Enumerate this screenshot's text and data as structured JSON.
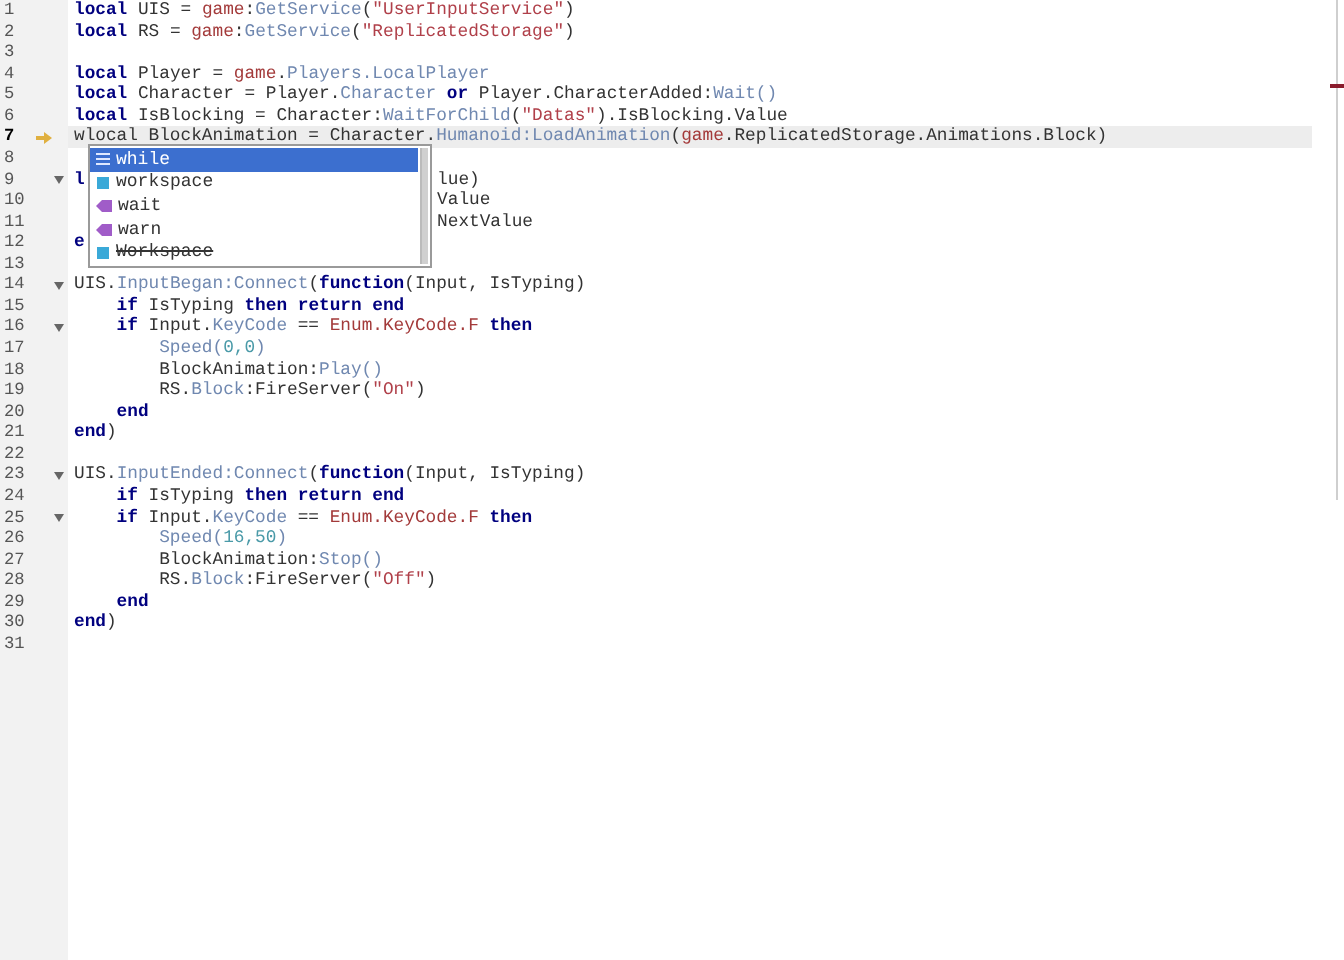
{
  "editor": {
    "lines": [
      {
        "number": "1",
        "fold": false,
        "current": false,
        "tokens": [
          {
            "kind": "keyword",
            "text": "local "
          },
          {
            "kind": "text",
            "text": "UIS = "
          },
          {
            "kind": "global",
            "text": "game"
          },
          {
            "kind": "text",
            "text": ":"
          },
          {
            "kind": "member",
            "text": "GetService"
          },
          {
            "kind": "text",
            "text": "("
          },
          {
            "kind": "string",
            "text": "\"UserInputService\""
          },
          {
            "kind": "text",
            "text": ")"
          }
        ]
      },
      {
        "number": "2",
        "fold": false,
        "current": false,
        "tokens": [
          {
            "kind": "keyword",
            "text": "local "
          },
          {
            "kind": "text",
            "text": "RS = "
          },
          {
            "kind": "global",
            "text": "game"
          },
          {
            "kind": "text",
            "text": ":"
          },
          {
            "kind": "member",
            "text": "GetService"
          },
          {
            "kind": "text",
            "text": "("
          },
          {
            "kind": "string",
            "text": "\"ReplicatedStorage\""
          },
          {
            "kind": "text",
            "text": ")"
          }
        ]
      },
      {
        "number": "3",
        "fold": false,
        "current": false
      },
      {
        "number": "4",
        "fold": false,
        "current": false,
        "tokens": [
          {
            "kind": "keyword",
            "text": "local "
          },
          {
            "kind": "text",
            "text": "Player = "
          },
          {
            "kind": "global",
            "text": "game"
          },
          {
            "kind": "text",
            "text": "."
          },
          {
            "kind": "member",
            "text": "Players.LocalPlayer"
          }
        ]
      },
      {
        "number": "5",
        "fold": false,
        "current": false,
        "tokens": [
          {
            "kind": "keyword",
            "text": "local "
          },
          {
            "kind": "text",
            "text": "Character = Player."
          },
          {
            "kind": "member",
            "text": "Character"
          },
          {
            "kind": "keyword",
            "text": " or"
          },
          {
            "kind": "text",
            "text": " Player.CharacterAdded:"
          },
          {
            "kind": "member",
            "text": "Wait()"
          }
        ]
      },
      {
        "number": "6",
        "fold": false,
        "current": false,
        "tokens": [
          {
            "kind": "keyword",
            "text": "local "
          },
          {
            "kind": "text",
            "text": "IsBlocking = Character:"
          },
          {
            "kind": "member",
            "text": "WaitForChild"
          },
          {
            "kind": "text",
            "text": "("
          },
          {
            "kind": "string",
            "text": "\"Datas\""
          },
          {
            "kind": "text",
            "text": ").IsBlocking.Value"
          }
        ]
      },
      {
        "number": "7",
        "fold": false,
        "current": true,
        "tokens": [
          {
            "kind": "text",
            "text": "wlocal BlockAnimation = Character."
          },
          {
            "kind": "member",
            "text": "Humanoid:LoadAnimation"
          },
          {
            "kind": "text",
            "text": "("
          },
          {
            "kind": "global",
            "text": "game"
          },
          {
            "kind": "text",
            "text": ".ReplicatedStorage.Animations.Block)"
          }
        ]
      },
      {
        "number": "8",
        "fold": false,
        "current": false
      },
      {
        "number": "9",
        "fold": true,
        "current": false,
        "tokens": [
          {
            "kind": "keyword",
            "text": "l"
          }
        ],
        "tail": [
          {
            "kind": "text",
            "text": "lue)"
          }
        ]
      },
      {
        "number": "10",
        "fold": false,
        "current": false,
        "tail": [
          {
            "kind": "text",
            "text": "Value"
          }
        ]
      },
      {
        "number": "11",
        "fold": false,
        "current": false,
        "tail": [
          {
            "kind": "text",
            "text": "NextValue"
          }
        ]
      },
      {
        "number": "12",
        "fold": false,
        "current": false,
        "tokens": [
          {
            "kind": "keyword",
            "text": "e"
          }
        ]
      },
      {
        "number": "13",
        "fold": false,
        "current": false
      },
      {
        "number": "14",
        "fold": true,
        "current": false,
        "tokens": [
          {
            "kind": "text",
            "text": "UIS."
          },
          {
            "kind": "member",
            "text": "InputBegan:Connect"
          },
          {
            "kind": "text",
            "text": "("
          },
          {
            "kind": "keyword",
            "text": "function"
          },
          {
            "kind": "text",
            "text": "(Input, IsTyping)"
          }
        ]
      },
      {
        "number": "15",
        "fold": false,
        "current": false,
        "tokens": [
          {
            "kind": "keyword",
            "text": "    if"
          },
          {
            "kind": "text",
            "text": " IsTyping "
          },
          {
            "kind": "keyword",
            "text": "then return end"
          }
        ]
      },
      {
        "number": "16",
        "fold": true,
        "current": false,
        "tokens": [
          {
            "kind": "keyword",
            "text": "    if"
          },
          {
            "kind": "text",
            "text": " Input."
          },
          {
            "kind": "member",
            "text": "KeyCode"
          },
          {
            "kind": "text",
            "text": " == "
          },
          {
            "kind": "global",
            "text": "Enum.KeyCode.F"
          },
          {
            "kind": "keyword",
            "text": " then"
          }
        ]
      },
      {
        "number": "17",
        "fold": false,
        "current": false,
        "tokens": [
          {
            "kind": "member",
            "text": "        Speed("
          },
          {
            "kind": "number",
            "text": "0,0"
          },
          {
            "kind": "member",
            "text": ")"
          }
        ]
      },
      {
        "number": "18",
        "fold": false,
        "current": false,
        "tokens": [
          {
            "kind": "text",
            "text": "        BlockAnimation:"
          },
          {
            "kind": "member",
            "text": "Play()"
          }
        ]
      },
      {
        "number": "19",
        "fold": false,
        "current": false,
        "tokens": [
          {
            "kind": "text",
            "text": "        RS."
          },
          {
            "kind": "member",
            "text": "Block"
          },
          {
            "kind": "text",
            "text": ":FireServer("
          },
          {
            "kind": "string",
            "text": "\"On\""
          },
          {
            "kind": "text",
            "text": ")"
          }
        ]
      },
      {
        "number": "20",
        "fold": false,
        "current": false,
        "tokens": [
          {
            "kind": "keyword",
            "text": "    end"
          }
        ]
      },
      {
        "number": "21",
        "fold": false,
        "current": false,
        "tokens": [
          {
            "kind": "keyword",
            "text": "end"
          },
          {
            "kind": "text",
            "text": ")"
          }
        ]
      },
      {
        "number": "22",
        "fold": false,
        "current": false
      },
      {
        "number": "23",
        "fold": true,
        "current": false,
        "tokens": [
          {
            "kind": "text",
            "text": "UIS."
          },
          {
            "kind": "member",
            "text": "InputEnded:Connect"
          },
          {
            "kind": "text",
            "text": "("
          },
          {
            "kind": "keyword",
            "text": "function"
          },
          {
            "kind": "text",
            "text": "(Input, IsTyping)"
          }
        ]
      },
      {
        "number": "24",
        "fold": false,
        "current": false,
        "tokens": [
          {
            "kind": "keyword",
            "text": "    if"
          },
          {
            "kind": "text",
            "text": " IsTyping "
          },
          {
            "kind": "keyword",
            "text": "then return end"
          }
        ]
      },
      {
        "number": "25",
        "fold": true,
        "current": false,
        "tokens": [
          {
            "kind": "keyword",
            "text": "    if"
          },
          {
            "kind": "text",
            "text": " Input."
          },
          {
            "kind": "member",
            "text": "KeyCode"
          },
          {
            "kind": "text",
            "text": " == "
          },
          {
            "kind": "global",
            "text": "Enum.KeyCode.F"
          },
          {
            "kind": "keyword",
            "text": " then"
          }
        ]
      },
      {
        "number": "26",
        "fold": false,
        "current": false,
        "tokens": [
          {
            "kind": "member",
            "text": "        Speed("
          },
          {
            "kind": "number",
            "text": "16,50"
          },
          {
            "kind": "member",
            "text": ")"
          }
        ]
      },
      {
        "number": "27",
        "fold": false,
        "current": false,
        "tokens": [
          {
            "kind": "text",
            "text": "        BlockAnimation:"
          },
          {
            "kind": "member",
            "text": "Stop()"
          }
        ]
      },
      {
        "number": "28",
        "fold": false,
        "current": false,
        "tokens": [
          {
            "kind": "text",
            "text": "        RS."
          },
          {
            "kind": "member",
            "text": "Block"
          },
          {
            "kind": "text",
            "text": ":FireServer("
          },
          {
            "kind": "string",
            "text": "\"Off\""
          },
          {
            "kind": "text",
            "text": ")"
          }
        ]
      },
      {
        "number": "29",
        "fold": false,
        "current": false,
        "tokens": [
          {
            "kind": "keyword",
            "text": "    end"
          }
        ]
      },
      {
        "number": "30",
        "fold": false,
        "current": false,
        "tokens": [
          {
            "kind": "keyword",
            "text": "end"
          },
          {
            "kind": "text",
            "text": ")"
          }
        ]
      },
      {
        "number": "31",
        "fold": false,
        "current": false
      }
    ]
  },
  "autocomplete": {
    "items": [
      {
        "label": "while",
        "kind": "keyword",
        "selected": true,
        "deprecated": false
      },
      {
        "label": "workspace",
        "kind": "variable",
        "selected": false,
        "deprecated": false
      },
      {
        "label": "wait",
        "kind": "function",
        "selected": false,
        "deprecated": false
      },
      {
        "label": "warn",
        "kind": "function",
        "selected": false,
        "deprecated": false
      },
      {
        "label": "Workspace",
        "kind": "variable",
        "selected": false,
        "deprecated": true
      }
    ]
  }
}
